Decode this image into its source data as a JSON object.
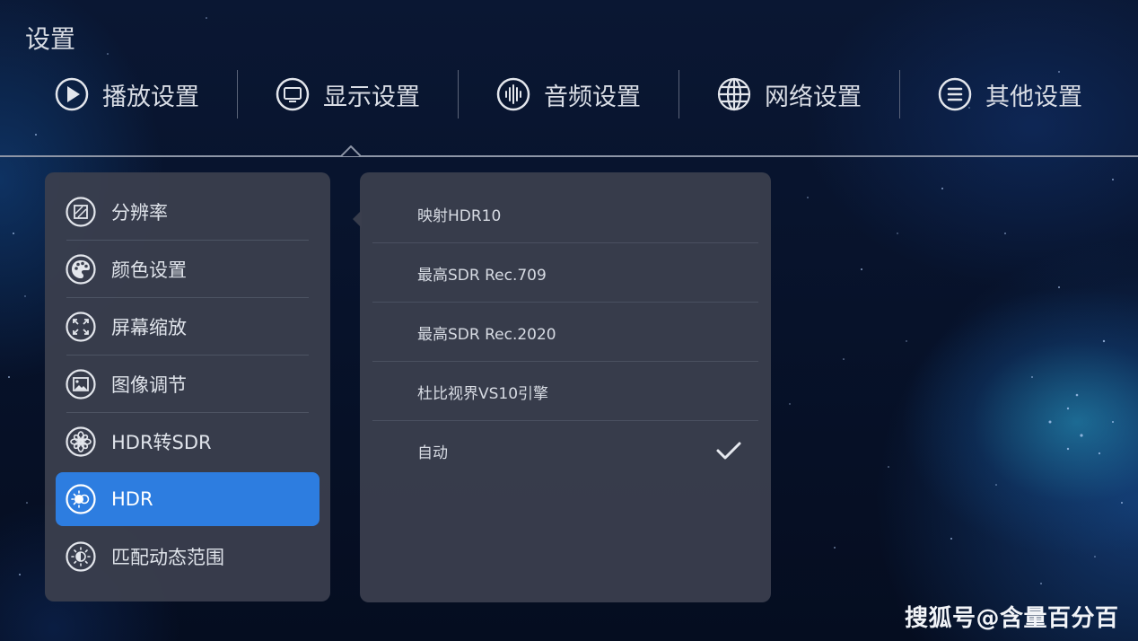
{
  "page": {
    "title": "设置"
  },
  "tabs": [
    {
      "label": "播放设置",
      "icon": "play-circle-icon"
    },
    {
      "label": "显示设置",
      "icon": "monitor-icon",
      "selected": true
    },
    {
      "label": "音频设置",
      "icon": "audio-wave-icon"
    },
    {
      "label": "网络设置",
      "icon": "globe-icon"
    },
    {
      "label": "其他设置",
      "icon": "menu-lines-icon"
    }
  ],
  "sidebar": {
    "items": [
      {
        "label": "分辨率",
        "icon": "resolution-icon"
      },
      {
        "label": "颜色设置",
        "icon": "palette-icon"
      },
      {
        "label": "屏幕缩放",
        "icon": "expand-arrows-icon"
      },
      {
        "label": "图像调节",
        "icon": "image-icon"
      },
      {
        "label": "HDR转SDR",
        "icon": "aperture-icon"
      },
      {
        "label": "HDR",
        "icon": "hdr-sun-icon",
        "active": true
      },
      {
        "label": "匹配动态范围",
        "icon": "half-sun-icon"
      }
    ]
  },
  "options": {
    "items": [
      {
        "label": "映射HDR10"
      },
      {
        "label": "最高SDR Rec.709"
      },
      {
        "label": "最高SDR Rec.2020"
      },
      {
        "label": "杜比视界VS10引擎"
      },
      {
        "label": "自动",
        "selected": true
      }
    ]
  },
  "watermark": "搜狐号@含量百分百",
  "colors": {
    "accent": "#2d7de0",
    "panel": "#3a3f4e",
    "background": "#07122a"
  }
}
